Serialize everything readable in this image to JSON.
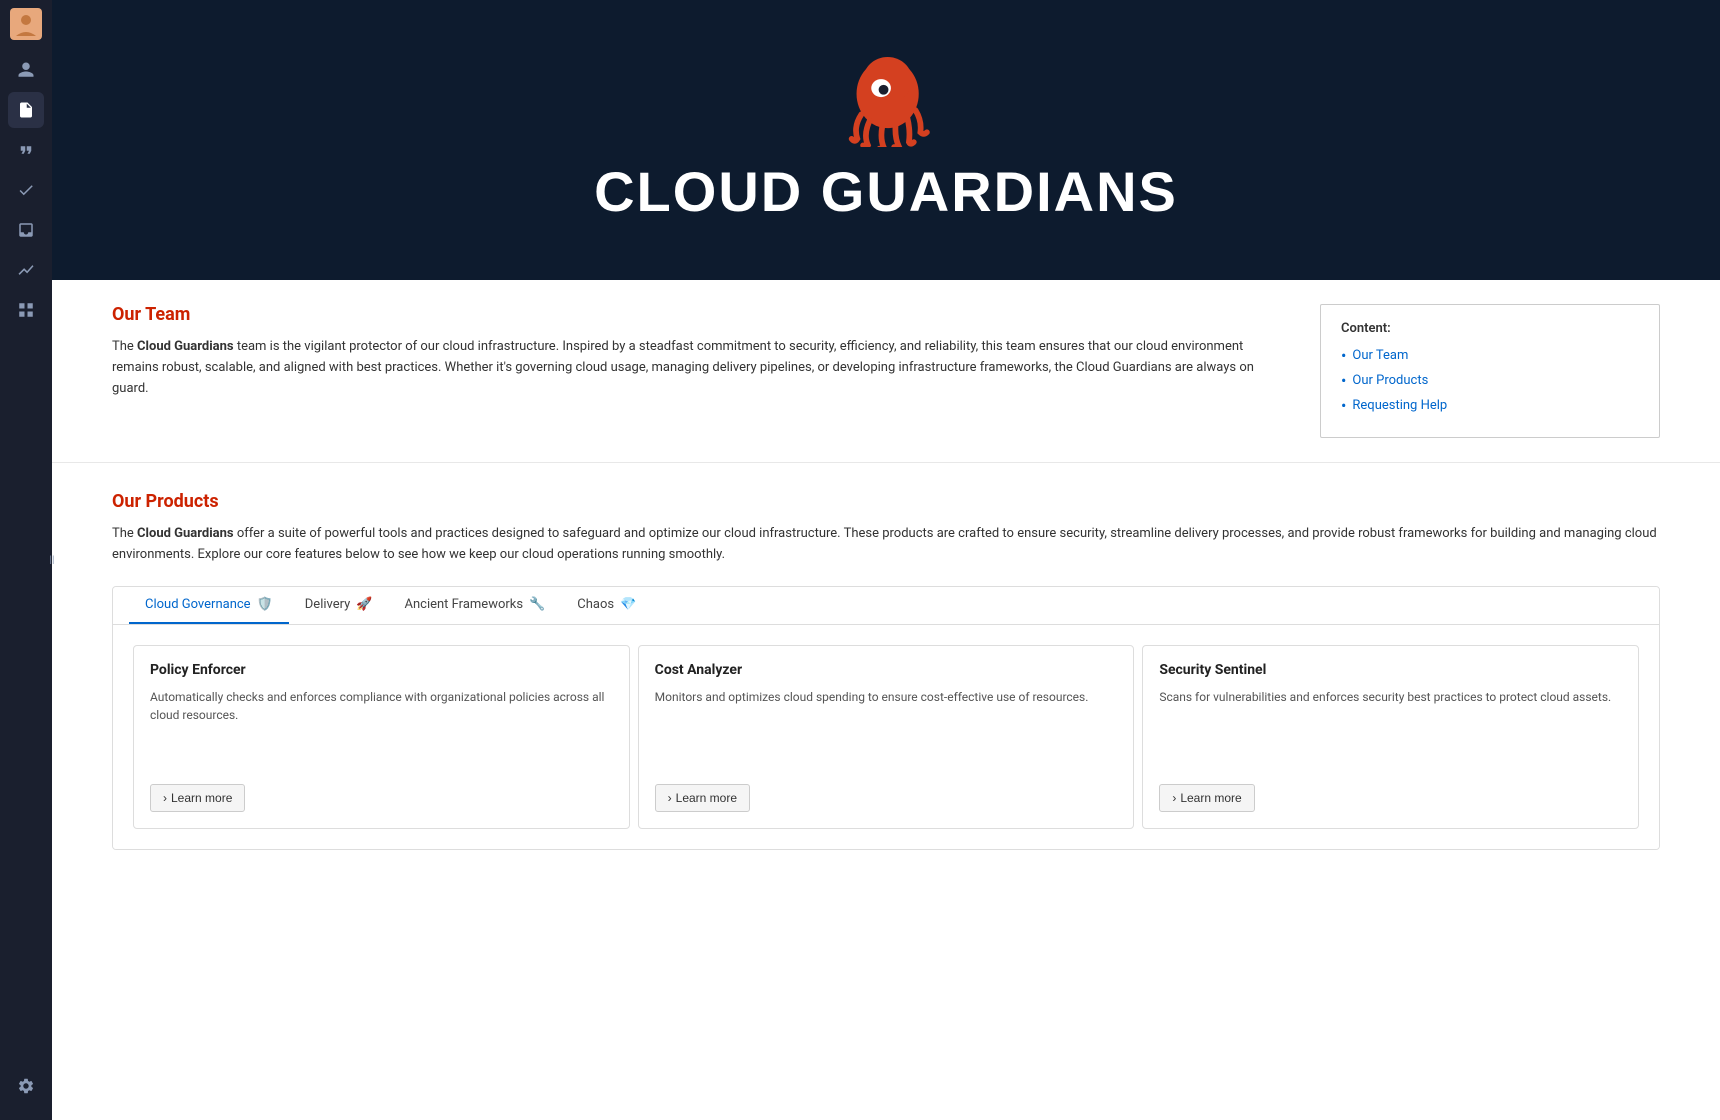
{
  "sidebar": {
    "icons": [
      {
        "name": "avatar-icon",
        "symbol": "👤"
      },
      {
        "name": "user-icon",
        "symbol": "👤"
      },
      {
        "name": "document-icon",
        "symbol": "📄"
      },
      {
        "name": "quote-icon",
        "symbol": "❝"
      },
      {
        "name": "check-icon",
        "symbol": "✓"
      },
      {
        "name": "inbox-icon",
        "symbol": "📥"
      },
      {
        "name": "chart-icon",
        "symbol": "∿"
      },
      {
        "name": "grid-icon",
        "symbol": "⊞"
      },
      {
        "name": "settings-icon",
        "symbol": "⚙"
      }
    ]
  },
  "hero": {
    "title": "CLOUD GUARDIANS"
  },
  "team_section": {
    "heading": "Our Team",
    "paragraph_start": "The ",
    "brand": "Cloud Guardians",
    "paragraph_body": " team is the vigilant protector of our cloud infrastructure. Inspired by a steadfast commitment to security, efficiency, and reliability, this team ensures that our cloud environment remains robust, scalable, and aligned with best practices. Whether it's governing cloud usage, managing delivery pipelines, or developing infrastructure frameworks, the Cloud Guardians are always on guard.",
    "content_box": {
      "title": "Content:",
      "items": [
        "Our Team",
        "Our Products",
        "Requesting Help"
      ]
    }
  },
  "products_section": {
    "heading": "Our Products",
    "desc_start": "The ",
    "brand": "Cloud Guardians",
    "desc_body": " offer a suite of powerful tools and practices designed to safeguard and optimize our cloud infrastructure. These products are crafted to ensure security, streamline delivery processes, and provide robust frameworks for building and managing cloud environments. Explore our core features below to see how we keep our cloud operations running smoothly.",
    "tabs": [
      {
        "label": "Cloud Governance",
        "emoji": "🛡️",
        "active": true
      },
      {
        "label": "Delivery",
        "emoji": "🚀",
        "active": false
      },
      {
        "label": "Ancient Frameworks",
        "emoji": "🔧",
        "active": false
      },
      {
        "label": "Chaos",
        "emoji": "💎",
        "active": false
      }
    ],
    "cards": [
      {
        "title": "Policy Enforcer",
        "desc": "Automatically checks and enforces compliance with organizational policies across all cloud resources.",
        "learn_more": "Learn more"
      },
      {
        "title": "Cost Analyzer",
        "desc": "Monitors and optimizes cloud spending to ensure cost-effective use of resources.",
        "learn_more": "Learn more"
      },
      {
        "title": "Security Sentinel",
        "desc": "Scans for vulnerabilities and enforces security best practices to protect cloud assets.",
        "learn_more": "Learn more"
      }
    ]
  }
}
